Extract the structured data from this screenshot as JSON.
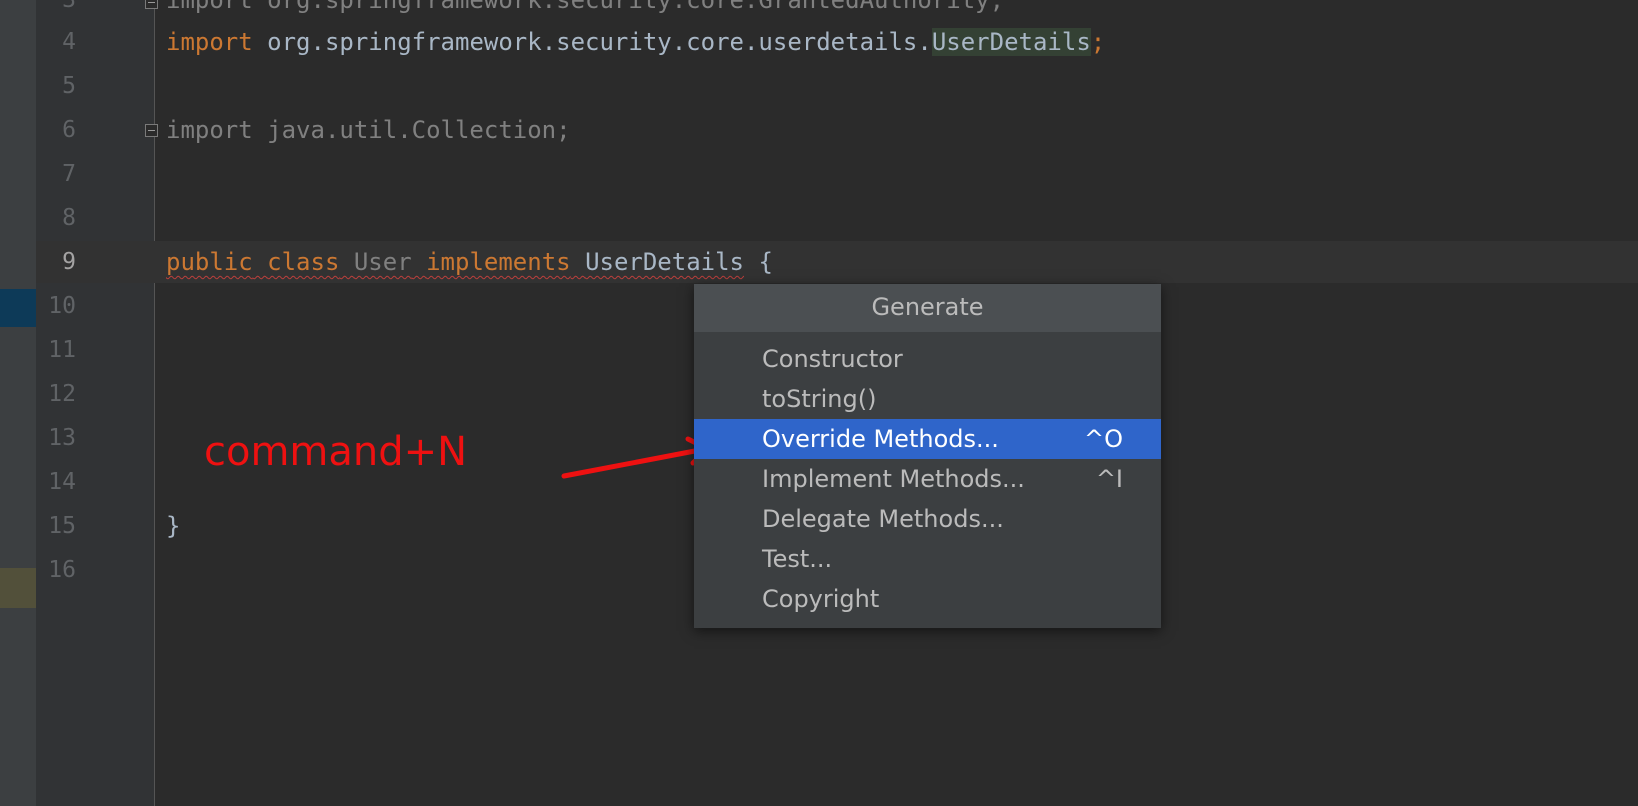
{
  "editor": {
    "line_numbers": [
      "3",
      "4",
      "5",
      "6",
      "7",
      "8",
      "9",
      "10",
      "11",
      "12",
      "13",
      "14",
      "15",
      "16"
    ],
    "line3": {
      "text": "import org.springframework.security.core.GrantedAuthority;"
    },
    "line4": {
      "kw": "import",
      "pkg": " org.springframework.security.core.userdetails.",
      "cls": "UserDetails",
      "semi": ";"
    },
    "line6": {
      "text": "import java.util.Collection;"
    },
    "line9": {
      "kw_public": "public",
      "kw_class": "class",
      "name": "User",
      "kw_implements": "implements",
      "iface": "UserDetails",
      "brace": " {"
    },
    "line15": {
      "text": "}"
    }
  },
  "popup": {
    "title": "Generate",
    "items": [
      {
        "label": "Constructor",
        "shortcut": ""
      },
      {
        "label": "toString()",
        "shortcut": ""
      },
      {
        "label": "Override Methods...",
        "shortcut": "^O"
      },
      {
        "label": "Implement Methods...",
        "shortcut": "^I"
      },
      {
        "label": "Delegate Methods...",
        "shortcut": ""
      },
      {
        "label": "Test...",
        "shortcut": ""
      },
      {
        "label": "Copyright",
        "shortcut": ""
      }
    ],
    "selected": "Override Methods..."
  },
  "annotation": {
    "text": "command+N",
    "color": "#ee1111"
  },
  "colors": {
    "background": "#2b2b2b",
    "keyword": "#cc7832",
    "selection": "#2f65ca",
    "popup": "#3c3f41"
  }
}
